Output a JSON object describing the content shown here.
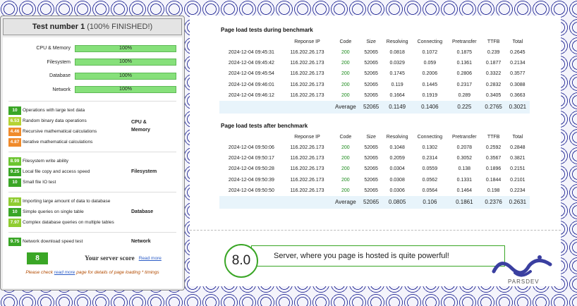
{
  "left": {
    "header_title": "Test number 1",
    "header_pct": "(100% FINISHED!)",
    "bars": [
      {
        "label": "CPU & Memory",
        "value": "100%"
      },
      {
        "label": "Filesystem",
        "value": "100%"
      },
      {
        "label": "Database",
        "value": "100%"
      },
      {
        "label": "Network",
        "value": "100%"
      }
    ],
    "groups": [
      {
        "title": "CPU & Memory",
        "tests": [
          {
            "score": "10",
            "label": "Operations with large text data",
            "color": "#3aa626"
          },
          {
            "score": "6.53",
            "label": "Random binary data operations",
            "color": "#b5d334"
          },
          {
            "score": "4.46",
            "label": "Recursive mathematical calculations",
            "color": "#f08a2a"
          },
          {
            "score": "4.87",
            "label": "Iterative mathematical calculations",
            "color": "#f08a2a"
          }
        ]
      },
      {
        "title": "Filesystem",
        "tests": [
          {
            "score": "8.99",
            "label": "Filesystem write ability",
            "color": "#6cc530"
          },
          {
            "score": "9.25",
            "label": "Local file copy and access speed",
            "color": "#3aa626"
          },
          {
            "score": "10",
            "label": "Small file IO test",
            "color": "#3aa626"
          }
        ]
      },
      {
        "title": "Database",
        "tests": [
          {
            "score": "7.81",
            "label": "Importing large amount of data to database",
            "color": "#8fcc30"
          },
          {
            "score": "10",
            "label": "Simple queries on single table",
            "color": "#3aa626"
          },
          {
            "score": "7.97",
            "label": "Complex database queries on multiple tables",
            "color": "#8fcc30"
          }
        ]
      },
      {
        "title": "Network",
        "tests": [
          {
            "score": "9.75",
            "label": "Network download speed test",
            "color": "#3aa626"
          }
        ]
      }
    ],
    "score": "8",
    "score_label": "Your server score",
    "read_more": "Read more",
    "footnote_pre": "Please check ",
    "footnote_link": "read more",
    "footnote_post": " page for details of page loading * timings"
  },
  "during": {
    "title": "Page load tests during benchmark",
    "headers": [
      "",
      "Reponse IP",
      "Code",
      "Size",
      "Resolving",
      "Connecting",
      "Pretransfer",
      "TTFB",
      "Total"
    ],
    "rows": [
      [
        "2024-12-04 09:45:31",
        "116.202.26.173",
        "200",
        "52065",
        "0.0818",
        "0.1072",
        "0.1875",
        "0.239",
        "0.2645"
      ],
      [
        "2024-12-04 09:45:42",
        "116.202.26.173",
        "200",
        "52065",
        "0.0329",
        "0.059",
        "0.1361",
        "0.1877",
        "0.2134"
      ],
      [
        "2024-12-04 09:45:54",
        "116.202.26.173",
        "200",
        "52065",
        "0.1745",
        "0.2006",
        "0.2806",
        "0.3322",
        "0.3577"
      ],
      [
        "2024-12-04 09:46:01",
        "116.202.26.173",
        "200",
        "52065",
        "0.119",
        "0.1445",
        "0.2317",
        "0.2832",
        "0.3088"
      ],
      [
        "2024-12-04 09:46:12",
        "116.202.26.173",
        "200",
        "52065",
        "0.1664",
        "0.1919",
        "0.289",
        "0.3405",
        "0.3663"
      ]
    ],
    "avg": [
      "Average",
      "52065",
      "0.1149",
      "0.1406",
      "0.225",
      "0.2765",
      "0.3021"
    ]
  },
  "after": {
    "title": "Page load tests after benchmark",
    "headers": [
      "",
      "Reponse IP",
      "Code",
      "Size",
      "Resolving",
      "Connecting",
      "Pretransfer",
      "TTFB",
      "Total"
    ],
    "rows": [
      [
        "2024-12-04 09:50:06",
        "116.202.26.173",
        "200",
        "52065",
        "0.1048",
        "0.1302",
        "0.2078",
        "0.2592",
        "0.2848"
      ],
      [
        "2024-12-04 09:50:17",
        "116.202.26.173",
        "200",
        "52065",
        "0.2059",
        "0.2314",
        "0.3052",
        "0.3567",
        "0.3821"
      ],
      [
        "2024-12-04 09:50:28",
        "116.202.26.173",
        "200",
        "52065",
        "0.0304",
        "0.0559",
        "0.138",
        "0.1896",
        "0.2151"
      ],
      [
        "2024-12-04 09:50:39",
        "116.202.26.173",
        "200",
        "52065",
        "0.0308",
        "0.0562",
        "0.1331",
        "0.1844",
        "0.2101"
      ],
      [
        "2024-12-04 09:50:50",
        "116.202.26.173",
        "200",
        "52065",
        "0.0306",
        "0.0564",
        "0.1464",
        "0.198",
        "0.2234"
      ]
    ],
    "avg": [
      "Average",
      "52065",
      "0.0805",
      "0.106",
      "0.1861",
      "0.2376",
      "0.2631"
    ]
  },
  "verdict": {
    "score": "8.0",
    "text": "Server, where you page is hosted is quite powerful!"
  },
  "logo": {
    "text": "PARSDEV",
    "brand_color": "#3a3fa0"
  }
}
